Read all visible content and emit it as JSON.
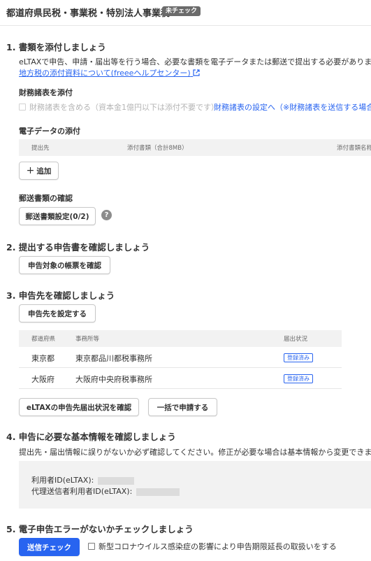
{
  "header": {
    "title": "都道府県民税・事業税・特別法人事業税",
    "badge": "未チェック"
  },
  "section1": {
    "title": "1. 書類を添付しましょう",
    "desc": "eLTAXで申告、申請・届出等を行う場合、必要な書類を電子データまたは郵送で提出する必要があります。",
    "help_link": "地方税の添付資料について(freeeヘルプセンター)",
    "financial": {
      "heading": "財務諸表を添付",
      "checkbox_label": "財務諸表を含める（資本金1億円以下は添付不要です）",
      "settings_link": "財務諸表の設定へ（※財務諸表を送信する場合は必"
    },
    "electronic": {
      "heading": "電子データの添付",
      "columns": [
        "提出先",
        "添付書類（合計8MB）",
        "添付書類名称"
      ],
      "add_button": "追加"
    },
    "mail": {
      "heading": "郵送書類の確認",
      "button": "郵送書類設定(0/2)"
    }
  },
  "section2": {
    "title": "2. 提出する申告書を確認しましょう",
    "button": "申告対象の帳票を確認"
  },
  "section3": {
    "title": "3. 申告先を確認しましょう",
    "button": "申告先を設定する",
    "columns": [
      "都道府県",
      "事務所等",
      "届出状況"
    ],
    "rows": [
      {
        "pref": "東京都",
        "office": "東京都品川都税事務所",
        "status": "登録済み"
      },
      {
        "pref": "大阪府",
        "office": "大阪府中央府税事務所",
        "status": "登録済み"
      }
    ],
    "check_button": "eLTAXの申告先届出状況を確認",
    "bulk_button": "一括で申請する"
  },
  "section4": {
    "title": "4. 申告に必要な基本情報を確認しましょう",
    "desc": "提出先・届出情報に誤りがないか必ず確認してください。修正が必要な場合は基本情報から変更できます。",
    "user_id_label": "利用者ID(eLTAX):",
    "proxy_id_label": "代理送信者利用者ID(eLTAX):"
  },
  "section5": {
    "title": "5. 電子申告エラーがないかチェックしましょう",
    "send_button": "送信チェック",
    "covid_label": "新型コロナウイルス感染症の影響により申告期限延長の取扱いをする"
  },
  "colors": {
    "accent": "#2864f0",
    "text": "#323232",
    "muted": "#b4b4b4"
  }
}
